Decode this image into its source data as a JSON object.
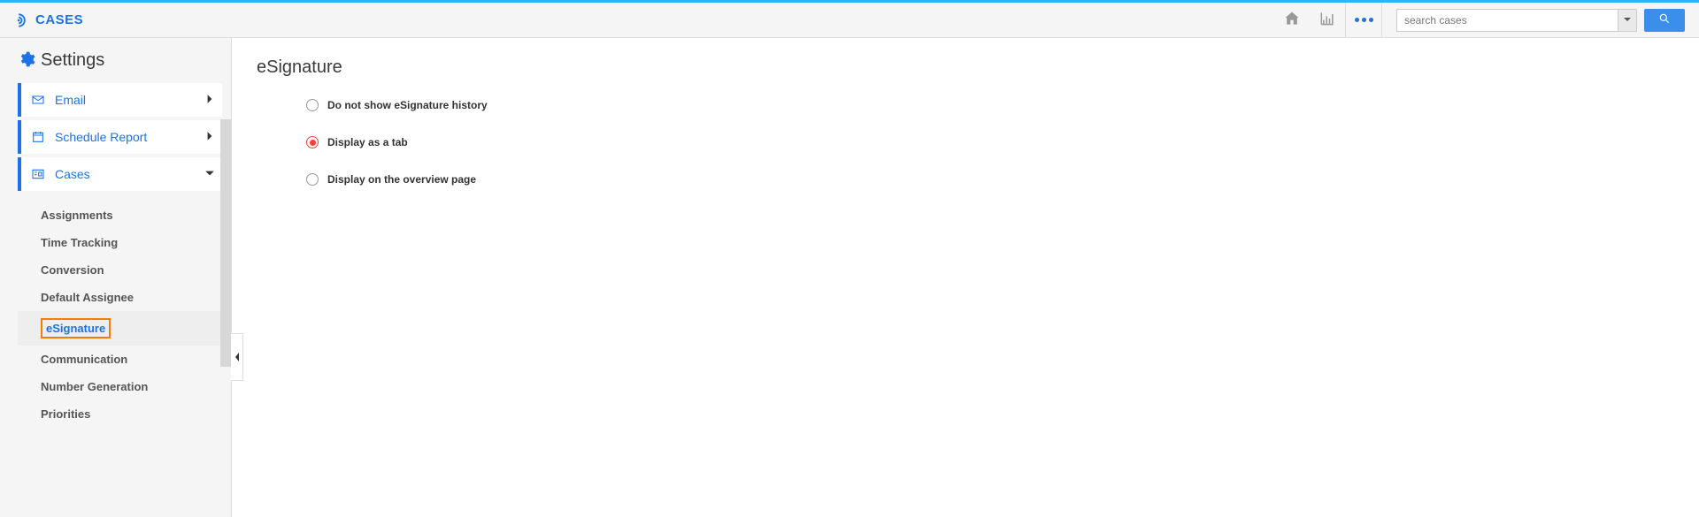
{
  "header": {
    "brand": "CASES",
    "search_placeholder": "search cases"
  },
  "sidebar": {
    "title": "Settings",
    "items": [
      {
        "label": "Email",
        "icon": "envelope-icon",
        "expanded": false
      },
      {
        "label": "Schedule Report",
        "icon": "calendar-icon",
        "expanded": false
      },
      {
        "label": "Cases",
        "icon": "list-box-icon",
        "expanded": true
      }
    ],
    "cases_sub": [
      {
        "label": "Assignments"
      },
      {
        "label": "Time Tracking"
      },
      {
        "label": "Conversion"
      },
      {
        "label": "Default Assignee"
      },
      {
        "label": "eSignature",
        "active": true
      },
      {
        "label": "Communication"
      },
      {
        "label": "Number Generation"
      },
      {
        "label": "Priorities"
      }
    ]
  },
  "content": {
    "title": "eSignature",
    "options": [
      {
        "label": "Do not show eSignature history",
        "selected": false
      },
      {
        "label": "Display as a tab",
        "selected": true
      },
      {
        "label": "Display on the overview page",
        "selected": false
      }
    ]
  }
}
